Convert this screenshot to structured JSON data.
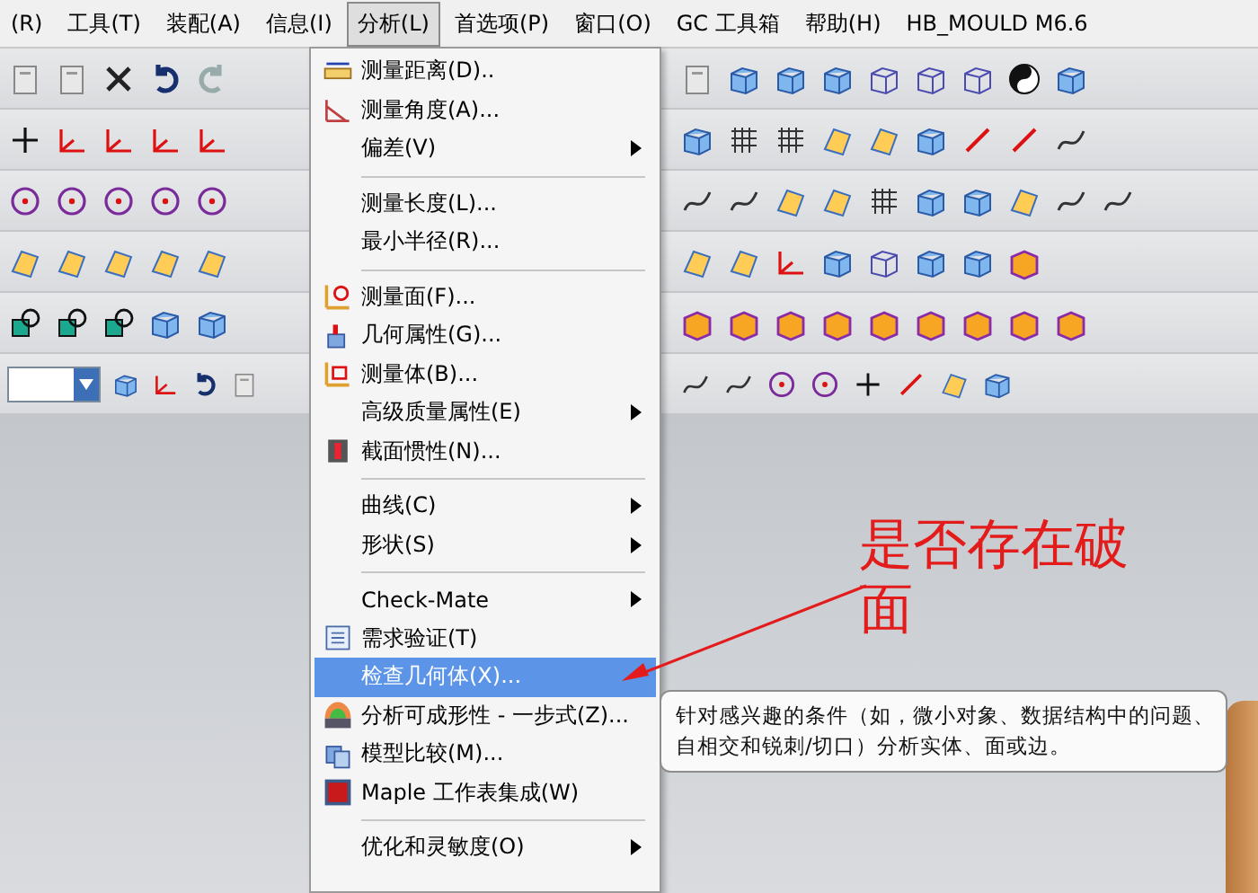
{
  "menubar": {
    "items": [
      {
        "label": "(R)",
        "selected": false
      },
      {
        "label": "工具(T)",
        "selected": false
      },
      {
        "label": "装配(A)",
        "selected": false
      },
      {
        "label": "信息(I)",
        "selected": false
      },
      {
        "label": "分析(L)",
        "selected": true
      },
      {
        "label": "首选项(P)",
        "selected": false
      },
      {
        "label": "窗口(O)",
        "selected": false
      },
      {
        "label": "GC 工具箱",
        "selected": false
      },
      {
        "label": "帮助(H)",
        "selected": false
      },
      {
        "label": "HB_MOULD M6.6",
        "selected": false
      }
    ]
  },
  "dropdown": {
    "items": [
      {
        "kind": "item",
        "label": "测量距离(D)..",
        "submenu": false,
        "selected": false
      },
      {
        "kind": "item",
        "label": "测量角度(A)...",
        "submenu": false,
        "selected": false
      },
      {
        "kind": "item",
        "label": "偏差(V)",
        "submenu": true,
        "selected": false
      },
      {
        "kind": "separator"
      },
      {
        "kind": "item",
        "label": "测量长度(L)...",
        "submenu": false,
        "selected": false
      },
      {
        "kind": "item",
        "label": "最小半径(R)...",
        "submenu": false,
        "selected": false
      },
      {
        "kind": "separator"
      },
      {
        "kind": "item",
        "label": "测量面(F)...",
        "submenu": false,
        "selected": false
      },
      {
        "kind": "item",
        "label": "几何属性(G)...",
        "submenu": false,
        "selected": false
      },
      {
        "kind": "item",
        "label": "测量体(B)...",
        "submenu": false,
        "selected": false
      },
      {
        "kind": "item",
        "label": "高级质量属性(E)",
        "submenu": true,
        "selected": false
      },
      {
        "kind": "item",
        "label": "截面惯性(N)...",
        "submenu": false,
        "selected": false
      },
      {
        "kind": "separator"
      },
      {
        "kind": "item",
        "label": "曲线(C)",
        "submenu": true,
        "selected": false
      },
      {
        "kind": "item",
        "label": "形状(S)",
        "submenu": true,
        "selected": false
      },
      {
        "kind": "separator"
      },
      {
        "kind": "item",
        "label": "Check-Mate",
        "submenu": true,
        "selected": false
      },
      {
        "kind": "item",
        "label": "需求验证(T)",
        "submenu": false,
        "selected": false
      },
      {
        "kind": "item",
        "label": "检查几何体(X)...",
        "submenu": false,
        "selected": true
      },
      {
        "kind": "item",
        "label": "分析可成形性 - 一步式(Z)...",
        "submenu": false,
        "selected": false
      },
      {
        "kind": "item",
        "label": "模型比较(M)...",
        "submenu": false,
        "selected": false
      },
      {
        "kind": "item",
        "label": "Maple 工作表集成(W)",
        "submenu": false,
        "selected": false
      },
      {
        "kind": "separator"
      },
      {
        "kind": "item",
        "label": "优化和灵敏度(O)",
        "submenu": true,
        "selected": false
      }
    ]
  },
  "tooltip": {
    "lines": [
      "针对感兴趣的条件（如，微小对象、数据结构中的问题、",
      "自相交和锐刺/切口）分析实体、面或边。"
    ]
  },
  "annotation": {
    "text": "是否存在破面"
  }
}
